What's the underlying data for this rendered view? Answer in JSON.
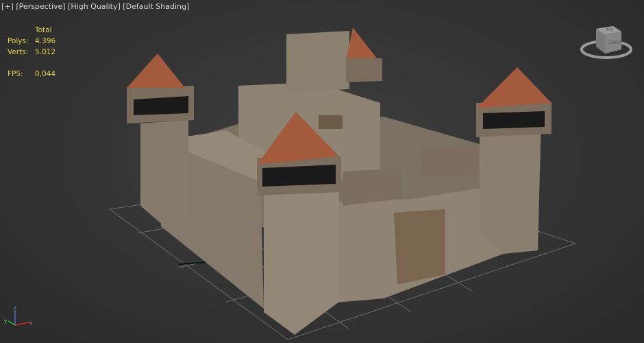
{
  "viewport": {
    "menu_plus": "[+]",
    "view_label": "[Perspective]",
    "quality_label": "[High Quality]",
    "shading_label": "[Default Shading]"
  },
  "stats": {
    "header": "Total",
    "polys_label": "Polys:",
    "polys_value": "4.396",
    "verts_label": "Verts:",
    "verts_value": "5.012",
    "fps_label": "FPS:",
    "fps_value": "0,044"
  },
  "viewcube": {
    "top": "TOP",
    "front": "FRONT"
  },
  "axis": {
    "x": "x",
    "y": "y",
    "z": "z"
  },
  "colors": {
    "stats_text": "#e6d34a",
    "stone": "#8c8273",
    "roof": "#a0583a",
    "wood": "#6e5a48"
  }
}
